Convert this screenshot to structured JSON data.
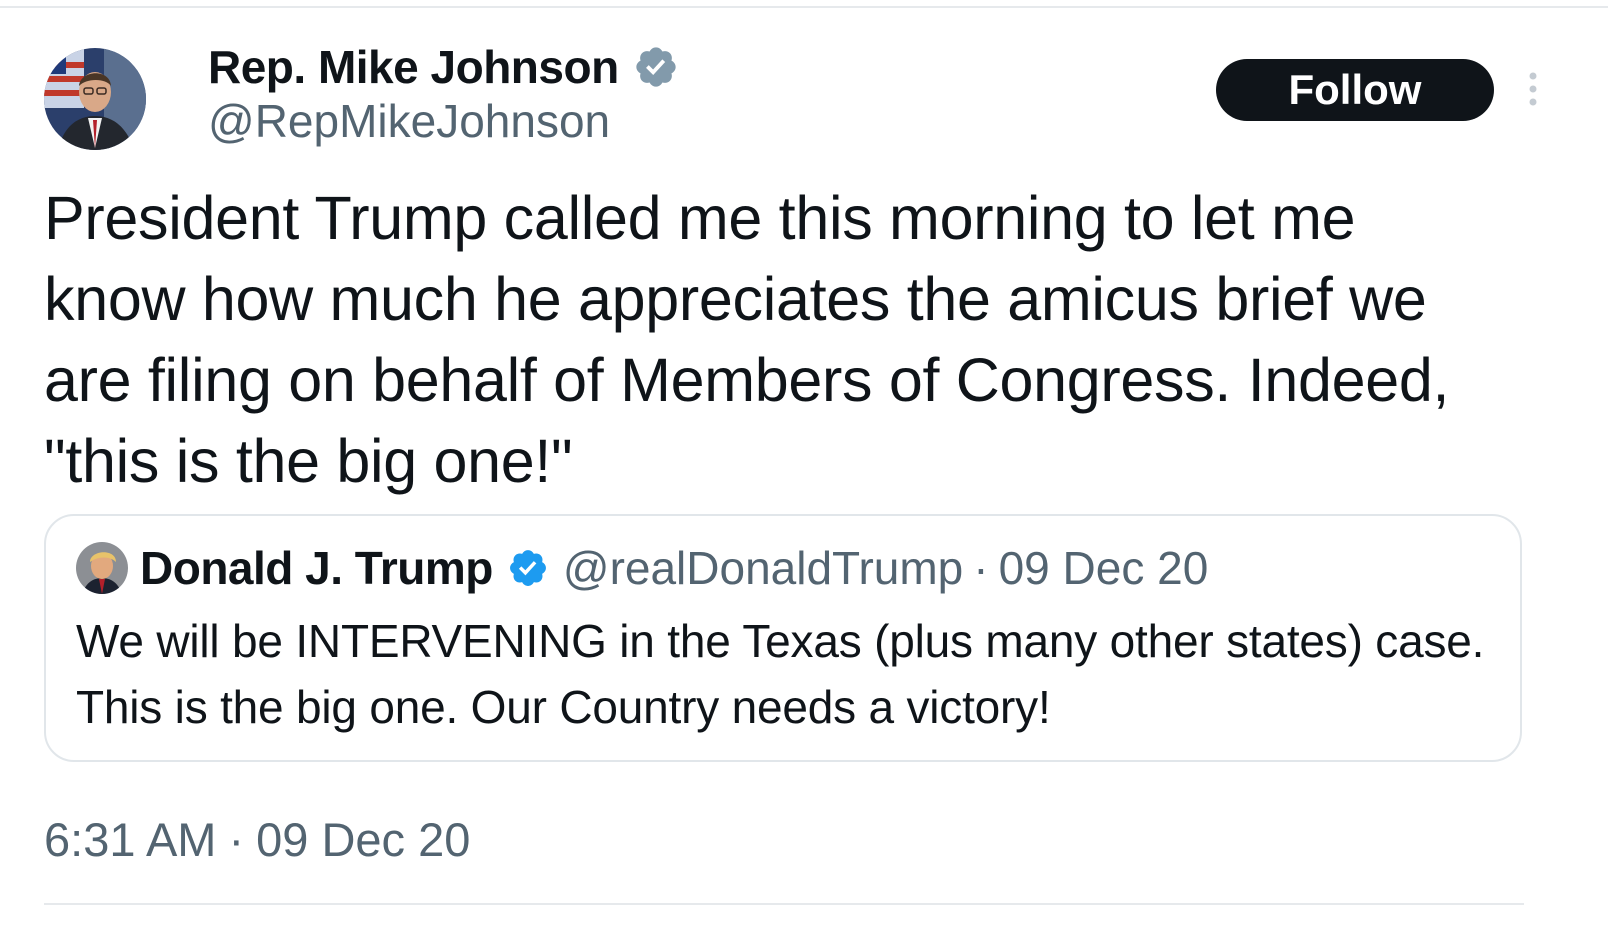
{
  "author": {
    "name": "Rep. Mike Johnson",
    "handle": "@RepMikeJohnson",
    "avatar_icon": "user-avatar-photo",
    "verified_icon": "verified-badge-gray"
  },
  "follow_button": {
    "label": "Follow"
  },
  "more_menu": {
    "icon": "more-vertical-icon"
  },
  "tweet": {
    "text": "President Trump called me this morning to let me know how much he appreciates the amicus brief we are filing on behalf of Members of Congress. Indeed, \"this is the big one!\""
  },
  "quoted_tweet": {
    "name": "Donald J. Trump",
    "handle": "@realDonaldTrump",
    "separator": "·",
    "date": "09 Dec 20",
    "text": "We will be INTERVENING in the Texas (plus many other states) case. This is the big one. Our Country needs a victory!",
    "verified_icon": "verified-badge-blue"
  },
  "timestamp": {
    "time": "6:31 AM",
    "separator": "·",
    "date": "09 Dec 20"
  },
  "colors": {
    "text_primary": "#0f1419",
    "text_secondary": "#536471",
    "verified_blue": "#1d9bf0",
    "verified_gray": "#829aab",
    "border": "#e1e6ea"
  }
}
